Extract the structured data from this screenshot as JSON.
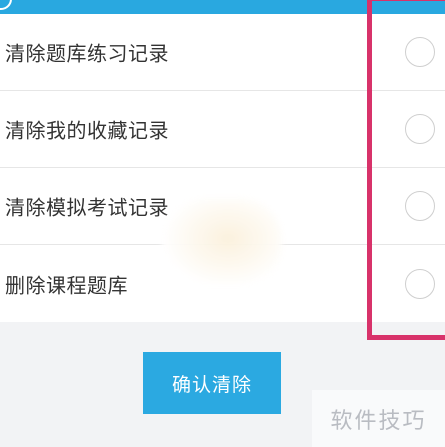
{
  "header": {
    "back_icon": "back-circle-icon",
    "color": "#29a8e0"
  },
  "options": [
    {
      "label": "清除题库练习记录"
    },
    {
      "label": "清除我的收藏记录"
    },
    {
      "label": "清除模拟考试记录"
    },
    {
      "label": "删除课程题库"
    }
  ],
  "confirm_button": {
    "label": "确认清除",
    "color": "#2ba9e1"
  },
  "highlight_color": "#d8326a",
  "watermark": {
    "text": "软件技巧"
  }
}
